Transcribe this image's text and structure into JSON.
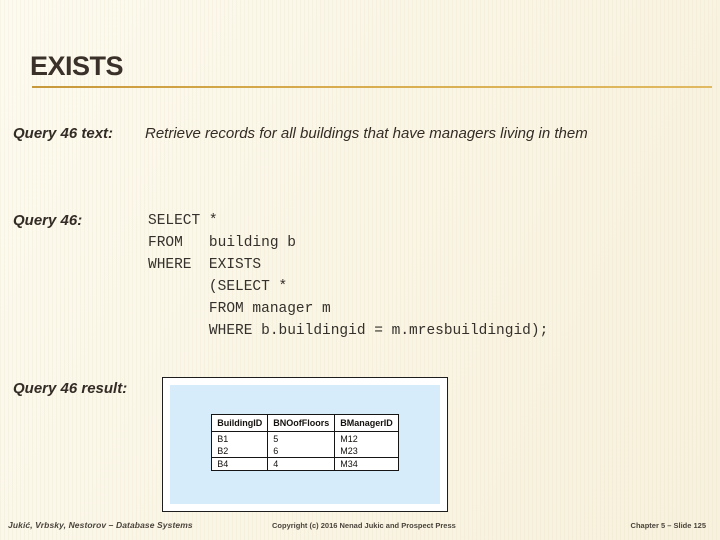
{
  "slide": {
    "title": "EXISTS",
    "accent_color": "#d0a243",
    "background_color": "#fbf7e8",
    "text_color": "#332c26"
  },
  "query_text": {
    "label": "Query 46 text:",
    "value": "Retrieve records for all buildings that have managers living in them"
  },
  "query_code": {
    "label": "Query 46:",
    "sql": "SELECT *\nFROM   building b\nWHERE  EXISTS\n       (SELECT *\n       FROM manager m\n       WHERE b.buildingid = m.mresbuildingid);"
  },
  "query_result": {
    "label": "Query 46 result:",
    "image_background": "#d7ecfa",
    "table": {
      "headers": [
        "BuildingID",
        "BNOofFloors",
        "BManagerID"
      ],
      "rows": [
        [
          "B1",
          "5",
          "M12"
        ],
        [
          "B2",
          "6",
          "M23"
        ],
        [
          "B4",
          "4",
          "M34"
        ]
      ]
    }
  },
  "footer": {
    "left": "Jukić, Vrbsky, Nestorov – Database Systems",
    "center": "Copyright (c) 2016 Nenad Jukic and Prospect Press",
    "right": "Chapter 5 – Slide 125"
  }
}
